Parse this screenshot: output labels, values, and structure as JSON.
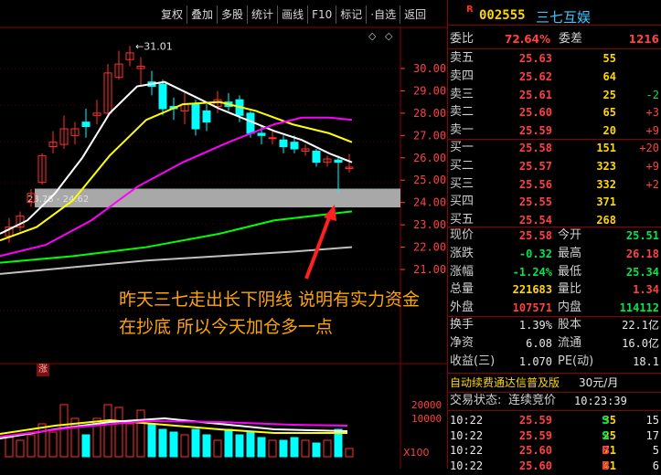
{
  "toolbar": {
    "buttons": [
      "复权",
      "叠加",
      "多股",
      "统计",
      "画线",
      "F10",
      "标记",
      "·自选",
      "返回"
    ]
  },
  "chart": {
    "price_axis": [
      "30.00",
      "29.00",
      "28.00",
      "27.00",
      "26.00",
      "25.00",
      "24.00",
      "23.00",
      "22.00",
      "21.00"
    ],
    "volume_axis": [
      "20000",
      "10000"
    ],
    "volume_unit": "X100",
    "high_label": "31.01",
    "range_label": "23.78 - 24.62",
    "annotation": "昨天三七走出长下阴线 说明有实力资金在抄底 所以今天加仓多一点",
    "zhang_badge": "涨",
    "colors": {
      "up": "#ff3030",
      "down": "#00ffff",
      "ma5": "#ffffff",
      "ma10": "#ffff00",
      "ma20": "#ff00ff",
      "ma60": "#00ff00",
      "ma120": "#c0c0c0"
    }
  },
  "stock": {
    "r_mark": "R",
    "code": "002555",
    "name": "三七互娱"
  },
  "ratio": {
    "label1": "委比",
    "value1": "72.64%",
    "label2": "委差",
    "value2": "1216"
  },
  "asks": [
    {
      "label": "卖五",
      "price": "25.63",
      "vol": "55",
      "chg": ""
    },
    {
      "label": "卖四",
      "price": "25.62",
      "vol": "64",
      "chg": ""
    },
    {
      "label": "卖三",
      "price": "25.61",
      "vol": "25",
      "chg": "-2"
    },
    {
      "label": "卖二",
      "price": "25.60",
      "vol": "65",
      "chg": "+3"
    },
    {
      "label": "卖一",
      "price": "25.59",
      "vol": "20",
      "chg": "+9"
    }
  ],
  "bids": [
    {
      "label": "买一",
      "price": "25.58",
      "vol": "151",
      "chg": "+20"
    },
    {
      "label": "买二",
      "price": "25.57",
      "vol": "323",
      "chg": "+9"
    },
    {
      "label": "买三",
      "price": "25.56",
      "vol": "332",
      "chg": "+2"
    },
    {
      "label": "买四",
      "price": "25.55",
      "vol": "371",
      "chg": ""
    },
    {
      "label": "买五",
      "price": "25.54",
      "vol": "268",
      "chg": ""
    }
  ],
  "quote": [
    {
      "l1": "现价",
      "v1": "25.58",
      "c1": "red",
      "l2": "今开",
      "v2": "25.51",
      "c2": "green"
    },
    {
      "l1": "涨跌",
      "v1": "-0.32",
      "c1": "green",
      "l2": "最高",
      "v2": "26.18",
      "c2": "red"
    },
    {
      "l1": "涨幅",
      "v1": "-1.24%",
      "c1": "green",
      "l2": "最低",
      "v2": "25.34",
      "c2": "green"
    },
    {
      "l1": "总量",
      "v1": "221683",
      "c1": "yellow",
      "l2": "量比",
      "v2": "1.34",
      "c2": "red"
    },
    {
      "l1": "外盘",
      "v1": "107571",
      "c1": "red",
      "l2": "内盘",
      "v2": "114112",
      "c2": "green"
    }
  ],
  "finance": [
    {
      "l1": "换手",
      "v1": "1.39%",
      "l2": "股本",
      "v2": "22.1亿"
    },
    {
      "l1": "净资",
      "v1": "6.08",
      "l2": "流通",
      "v2": "16.0亿"
    },
    {
      "l1": "收益(三)",
      "v1": "1.070",
      "l2": "PE(动)",
      "v2": "18.1"
    }
  ],
  "promo": {
    "text": "自动续费通达信普及版",
    "price": "30元/月"
  },
  "trade_status": {
    "label": "交易状态:",
    "value": "连续竞价",
    "time": "10:23:39"
  },
  "ticks": [
    {
      "time": "10:22",
      "price": "25.59",
      "vol": "35",
      "side": "S",
      "n": "15"
    },
    {
      "time": "10:22",
      "price": "25.59",
      "vol": "25",
      "side": "S",
      "n": "17"
    },
    {
      "time": "10:22",
      "price": "25.60",
      "vol": "71",
      "side": "B",
      "n": "5"
    },
    {
      "time": "10:22",
      "price": "25.60",
      "vol": "41",
      "side": "B",
      "n": "6"
    }
  ]
}
